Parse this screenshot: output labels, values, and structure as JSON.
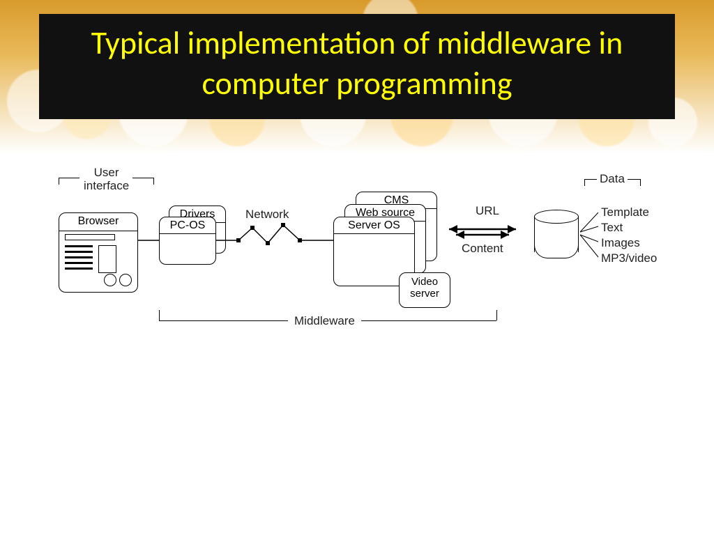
{
  "title": "Typical implementation of middleware in computer programming",
  "sections": {
    "user_interface": "User\ninterface",
    "data": "Data",
    "middleware": "Middleware"
  },
  "nodes": {
    "browser": "Browser",
    "drivers": "Drivers",
    "pc_os": "PC-OS",
    "network": "Network",
    "cms": "CMS",
    "web_source": "Web source",
    "server_os": "Server OS",
    "video_server": "Video\nserver",
    "url": "URL",
    "content": "Content"
  },
  "data_items": {
    "template": "Template",
    "text": "Text",
    "images": "Images",
    "mp3_video": "MP3/video"
  }
}
